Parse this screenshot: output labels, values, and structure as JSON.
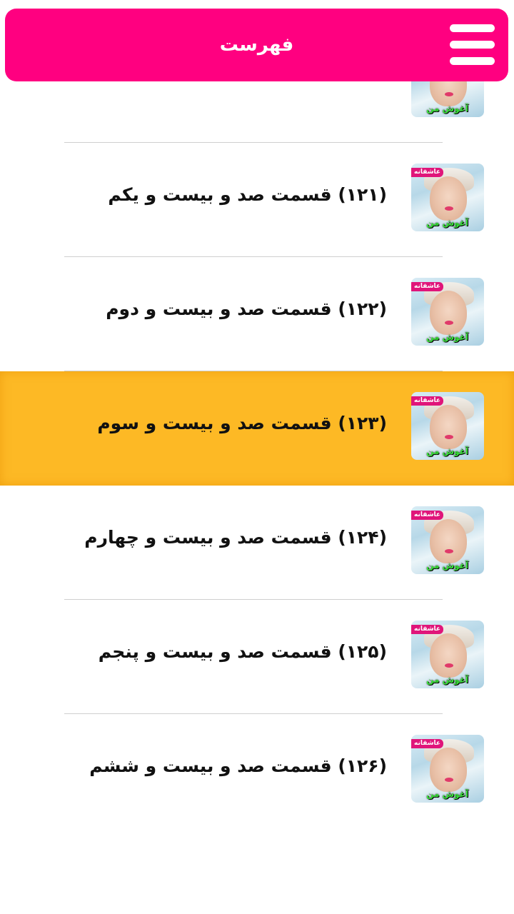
{
  "header": {
    "title": "فهرست",
    "accent": "#ff0080"
  },
  "thumbnail": {
    "tag_top": "عاشقانه",
    "tag_bottom": "آغوش من"
  },
  "active_color": "#fdb925",
  "items": [
    {
      "label": ""
    },
    {
      "label": "(۱۲۱)  قسمت صد و بیست و یکم"
    },
    {
      "label": "(۱۲۲)  قسمت صد و بیست و دوم"
    },
    {
      "label": "(۱۲۳)  قسمت صد و بیست و سوم",
      "active": true
    },
    {
      "label": "(۱۲۴)  قسمت صد و بیست و چهارم"
    },
    {
      "label": "(۱۲۵)  قسمت صد و بیست و پنجم"
    },
    {
      "label": "(۱۲۶)  قسمت صد و بیست و ششم"
    }
  ]
}
